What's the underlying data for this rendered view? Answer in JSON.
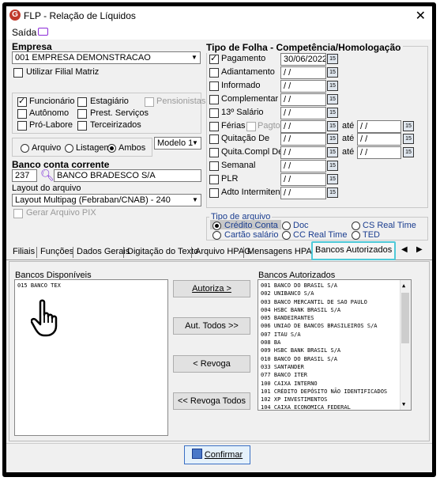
{
  "window": {
    "title": "FLP - Relação de Líquidos",
    "close": "✕"
  },
  "menu": {
    "saida": "Saída"
  },
  "empresa": {
    "label": "Empresa",
    "value": "001 EMPRESA DEMONSTRACAO",
    "filial_matriz": "Utilizar Filial Matriz"
  },
  "categorias": {
    "funcionario": "Funcionário",
    "estagiario": "Estagiário",
    "pensionistas": "Pensionistas",
    "autonomo": "Autônomo",
    "prest_servicos": "Prest. Serviços",
    "pro_labore": "Pró-Labore",
    "terceirizados": "Terceirizados"
  },
  "saida_tipo": {
    "arquivo": "Arquivo",
    "listagem": "Listagem",
    "ambos": "Ambos",
    "modelo": "Modelo 1"
  },
  "banco": {
    "label": "Banco conta corrente",
    "codigo": "237",
    "nome": "BANCO BRADESCO S/A"
  },
  "layout": {
    "label": "Layout do arquivo",
    "value": "Layout Multipag (Febraban/CNAB) - 240",
    "pix": "Gerar Arquivo PIX"
  },
  "tipo_folha": {
    "header": "Tipo de Folha  -  Competência/Homologação",
    "ate": "até",
    "empty_date": " / /",
    "items": [
      {
        "label": "Pagamento",
        "checked": true,
        "date": "30/06/2022"
      },
      {
        "label": "Adiantamento",
        "checked": false,
        "date": " / /"
      },
      {
        "label": "Informado",
        "checked": false,
        "date": " / /"
      },
      {
        "label": "Complementar",
        "checked": false,
        "date": " / /"
      },
      {
        "label": "13º Salário",
        "checked": false,
        "date": " / /"
      },
      {
        "label": "Férias",
        "checked": false,
        "date": " / /"
      },
      {
        "label": "Quitação De",
        "checked": false,
        "date": " / /"
      },
      {
        "label": "Quita.Compl De",
        "checked": false,
        "date": " / /"
      },
      {
        "label": "Semanal",
        "checked": false,
        "date": " / /"
      },
      {
        "label": "PLR",
        "checked": false,
        "date": " / /"
      },
      {
        "label": "Adto Intermitente",
        "checked": false,
        "date": " / /"
      }
    ],
    "pagto": "Pagto"
  },
  "tipo_arquivo": {
    "label": "Tipo de arquivo",
    "credito_conta": "Crédito Conta",
    "doc": "Doc",
    "cs_real_time": "CS Real Time",
    "cartao_salario": "Cartão salário",
    "cc_real_time": "CC Real Time",
    "ted": "TED"
  },
  "tabs": [
    "Filiais",
    "Funções",
    "Dados Gerais",
    "Digitação do Texto",
    "Arquivo HPAG",
    "Mensagens HPAG",
    "Bancos Autorizados"
  ],
  "bancos_disponiveis": {
    "label": "Bancos Disponíveis",
    "items": [
      "015 BANCO TEX"
    ]
  },
  "bancos_autorizados": {
    "label": "Bancos Autorizados",
    "items": [
      "001 BANCO DO BRASIL S/A",
      "002 UNIBANCO S/A",
      "003 BANCO MERCANTIL DE SAO PAULO",
      "004 HSBC BANK BRASIL S/A",
      "005 BANDEIRANTES",
      "006 UNIAO DE BANCOS BRASILEIROS S/A",
      "007 ITAU S/A",
      "008 BA",
      "009 HSBC BANK BRASIL S/A",
      "010 BANCO DO BRASIL S/A",
      "033 SANTANDER",
      "077 BANCO ITER",
      "100 CAIXA INTERNO",
      "101 CRÉDITO DEPÓSITO NÃO IDENTIFICADOS",
      "102 XP INVESTIMENTOS",
      "104 CAIXA ECONOMICA FEDERAL"
    ]
  },
  "buttons": {
    "autoriza": "Autoriza >",
    "aut_todos": "Aut. Todos >>",
    "revoga": "< Revoga",
    "revoga_todos": "<< Revoga Todos",
    "confirmar": "Confirmar"
  }
}
